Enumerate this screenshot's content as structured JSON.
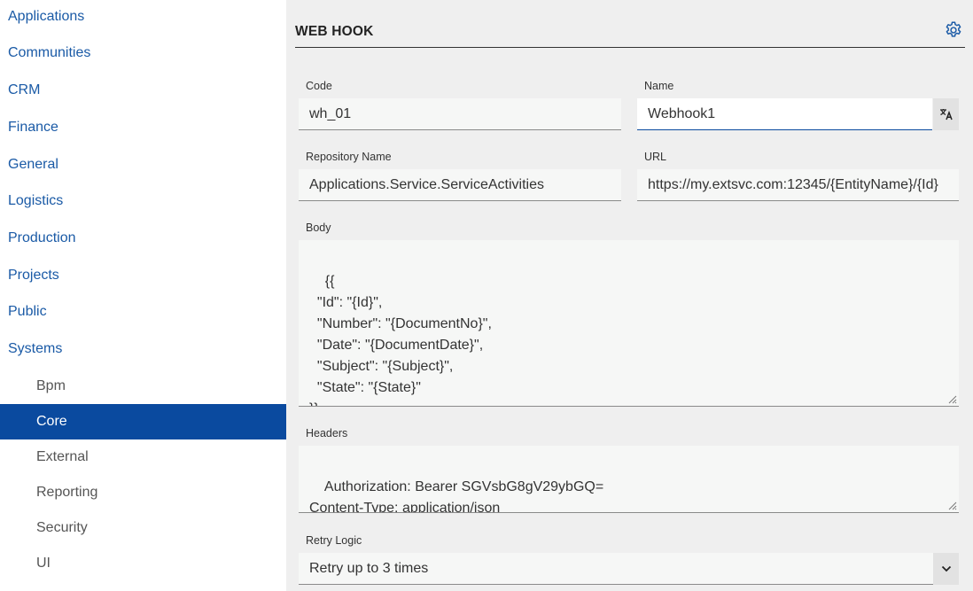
{
  "sidebar": {
    "items": [
      {
        "label": "Applications"
      },
      {
        "label": "Communities"
      },
      {
        "label": "CRM"
      },
      {
        "label": "Finance"
      },
      {
        "label": "General"
      },
      {
        "label": "Logistics"
      },
      {
        "label": "Production"
      },
      {
        "label": "Projects"
      },
      {
        "label": "Public"
      },
      {
        "label": "Systems"
      }
    ],
    "subitems": [
      {
        "label": "Bpm"
      },
      {
        "label": "Core",
        "active": true
      },
      {
        "label": "External"
      },
      {
        "label": "Reporting"
      },
      {
        "label": "Security"
      },
      {
        "label": "UI"
      }
    ]
  },
  "header": {
    "title": "WEB HOOK",
    "settings_icon": "gear-icon"
  },
  "form": {
    "code": {
      "label": "Code",
      "value": "wh_01"
    },
    "name": {
      "label": "Name",
      "value": "Webhook1",
      "translate_icon": "translate-icon"
    },
    "repository": {
      "label": "Repository Name",
      "value": "Applications.Service.ServiceActivities"
    },
    "url": {
      "label": "URL",
      "value": "https://my.extsvc.com:12345/{EntityName}/{Id}"
    },
    "body": {
      "label": "Body",
      "value": "{{\n  \"Id\": \"{Id}\",\n  \"Number\": \"{DocumentNo}\",\n  \"Date\": \"{DocumentDate}\",\n  \"Subject\": \"{Subject}\",\n  \"State\": \"{State}\"\n}}"
    },
    "headers": {
      "label": "Headers",
      "value": "Authorization: Bearer SGVsbG8gV29ybGQ=\nContent-Type: application/json"
    },
    "retry": {
      "label": "Retry Logic",
      "value": "Retry up to 3 times",
      "dropdown_icon": "chevron-down-icon"
    }
  },
  "colors": {
    "accent": "#0a4a9f",
    "link": "#1a5aa6",
    "panel_bg": "#efefef",
    "field_bg": "#f6f7f6"
  }
}
